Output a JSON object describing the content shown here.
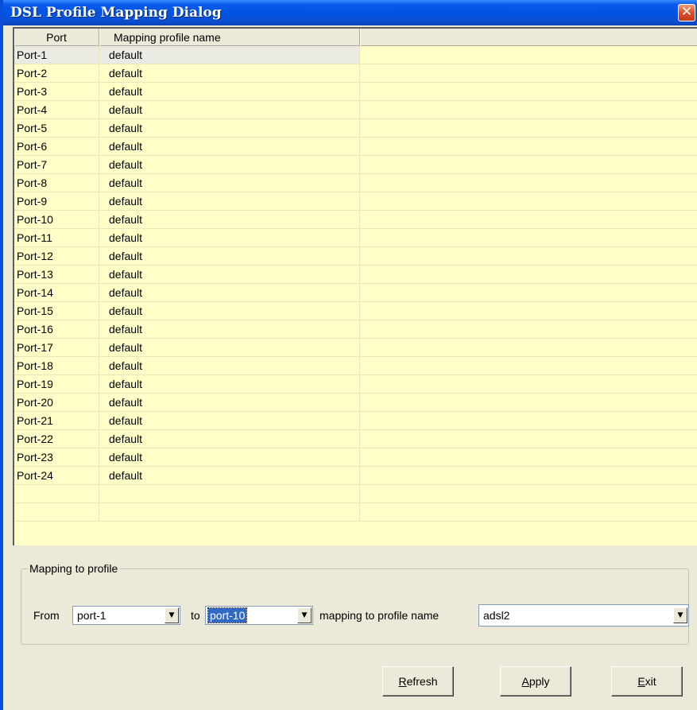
{
  "window": {
    "title": "DSL Profile Mapping Dialog",
    "close_glyph": "✕"
  },
  "grid": {
    "headers": {
      "port": "Port",
      "name": "Mapping profile name",
      "extra": ""
    },
    "rows": [
      {
        "port": "Port-1",
        "name": "default"
      },
      {
        "port": "Port-2",
        "name": "default"
      },
      {
        "port": "Port-3",
        "name": "default"
      },
      {
        "port": "Port-4",
        "name": "default"
      },
      {
        "port": "Port-5",
        "name": "default"
      },
      {
        "port": "Port-6",
        "name": "default"
      },
      {
        "port": "Port-7",
        "name": "default"
      },
      {
        "port": "Port-8",
        "name": "default"
      },
      {
        "port": "Port-9",
        "name": "default"
      },
      {
        "port": "Port-10",
        "name": "default"
      },
      {
        "port": "Port-11",
        "name": "default"
      },
      {
        "port": "Port-12",
        "name": "default"
      },
      {
        "port": "Port-13",
        "name": "default"
      },
      {
        "port": "Port-14",
        "name": "default"
      },
      {
        "port": "Port-15",
        "name": "default"
      },
      {
        "port": "Port-16",
        "name": "default"
      },
      {
        "port": "Port-17",
        "name": "default"
      },
      {
        "port": "Port-18",
        "name": "default"
      },
      {
        "port": "Port-19",
        "name": "default"
      },
      {
        "port": "Port-20",
        "name": "default"
      },
      {
        "port": "Port-21",
        "name": "default"
      },
      {
        "port": "Port-22",
        "name": "default"
      },
      {
        "port": "Port-23",
        "name": "default"
      },
      {
        "port": "Port-24",
        "name": "default"
      },
      {
        "port": "",
        "name": ""
      },
      {
        "port": "",
        "name": ""
      }
    ],
    "selected_row": 0,
    "colors": {
      "row_bg": "#ffffc8",
      "selected_bg": "#ecebe3"
    }
  },
  "mapping": {
    "legend": "Mapping to profile",
    "from_label": "From",
    "from_value": "port-1",
    "to_label": "to",
    "to_value": "port-10",
    "profile_label": "mapping to profile name",
    "profile_value": "adsl2",
    "dropdown_arrow": "▼"
  },
  "buttons": {
    "refresh": {
      "mnemonic": "R",
      "rest": "efresh"
    },
    "apply": {
      "mnemonic": "A",
      "rest": "pply"
    },
    "exit": {
      "mnemonic": "E",
      "rest": "xit"
    }
  }
}
